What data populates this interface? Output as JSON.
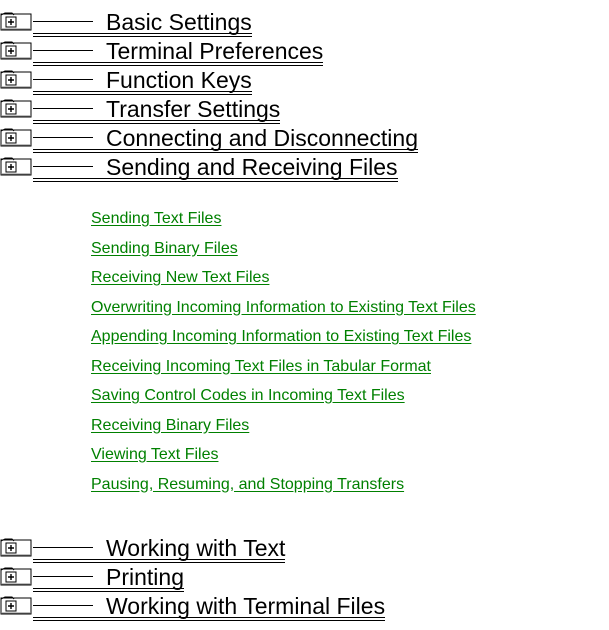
{
  "topics_top": [
    {
      "label": "Basic Settings",
      "icon": "book-icon"
    },
    {
      "label": "Terminal Preferences",
      "icon": "book-icon"
    },
    {
      "label": "Function Keys",
      "icon": "book-icon"
    },
    {
      "label": "Transfer Settings",
      "icon": "book-icon"
    },
    {
      "label": "Connecting and Disconnecting",
      "icon": "book-icon"
    },
    {
      "label": "Sending and Receiving Files",
      "icon": "book-icon"
    }
  ],
  "subtopics": [
    "Sending Text Files",
    "Sending Binary Files",
    "Receiving New Text Files",
    "Overwriting Incoming Information to Existing Text Files",
    "Appending Incoming Information to Existing Text Files",
    "Receiving Incoming Text Files in Tabular Format",
    "Saving Control Codes in Incoming Text Files",
    "Receiving Binary Files",
    "Viewing Text Files",
    "Pausing, Resuming, and Stopping Transfers"
  ],
  "topics_bottom": [
    {
      "label": "Working with Text",
      "icon": "book-icon"
    },
    {
      "label": "Printing",
      "icon": "book-icon"
    },
    {
      "label": "Working with Terminal Files",
      "icon": "book-icon"
    }
  ],
  "colors": {
    "link": "#008000",
    "icon_fill": "#ffffff",
    "icon_shadow": "#808080"
  }
}
